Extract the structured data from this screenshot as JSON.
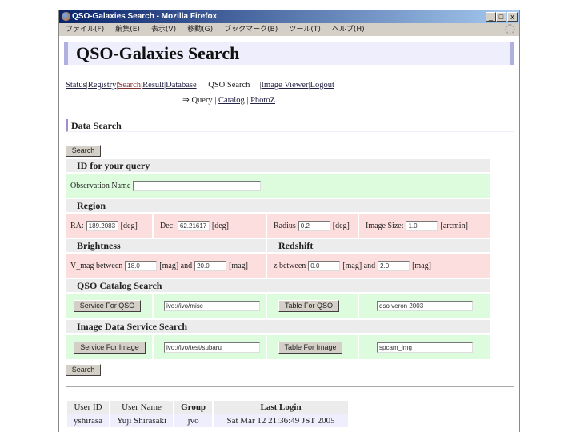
{
  "window": {
    "title": "QSO-Galaxies Search - Mozilla Firefox",
    "controls": [
      "_",
      "□",
      "x"
    ]
  },
  "menu": [
    "ファイル(F)",
    "編集(E)",
    "表示(V)",
    "移動(G)",
    "ブックマーク(B)",
    "ツール(T)",
    "ヘルプ(H)"
  ],
  "page_title": "QSO-Galaxies Search",
  "nav": {
    "items": [
      "Status",
      "Registry",
      "Search",
      "Result",
      "Database"
    ],
    "current": "QSO Search",
    "after": [
      "Image Viewer",
      "Logout"
    ],
    "sep": "|"
  },
  "subnav": {
    "arrow": "⇒",
    "current": "Query",
    "links": [
      "Catalog",
      "PhotoZ"
    ],
    "sep": "|"
  },
  "section_title": "Data Search",
  "search_label": "Search",
  "id_section": {
    "title": "ID for your query",
    "obs_label": "Observation Name",
    "obs_value": ""
  },
  "region": {
    "title": "Region",
    "ra_label": "RA:",
    "ra_value": "189.2083",
    "ra_unit": "[deg]",
    "dec_label": "Dec:",
    "dec_value": "62.21617",
    "dec_unit": "[deg]",
    "radius_label": "Radius",
    "radius_value": "0.2",
    "radius_unit": "[deg]",
    "size_label": "Image Size:",
    "size_value": "1.0",
    "size_unit": "[arcmin]"
  },
  "brightness": {
    "title": "Brightness",
    "label": "V_mag between",
    "min": "18.0",
    "mid": "[mag] and",
    "max": "20.0",
    "unit": "[mag]"
  },
  "redshift": {
    "title": "Redshift",
    "label": "z between",
    "min": "0.0",
    "mid": "[mag] and",
    "max": "2.0",
    "unit": "[mag]"
  },
  "qso": {
    "title": "QSO Catalog Search",
    "service_btn": "Service For QSO",
    "service_value": "ivo://ivo/misc",
    "table_btn": "Table For QSO",
    "table_value": "qso veron 2003"
  },
  "image": {
    "title": "Image Data Service Search",
    "service_btn": "Service For Image",
    "service_value": "ivo://ivo/test/subaru",
    "table_btn": "Table For Image",
    "table_value": "spcam_img"
  },
  "users": {
    "headers": [
      "User ID",
      "User Name",
      "Group",
      "Last Login"
    ],
    "rows": [
      [
        "yshirasa",
        "Yuji Shirasaki",
        "jvo",
        "Sat Mar 12 21:36:49 JST 2005"
      ]
    ]
  }
}
